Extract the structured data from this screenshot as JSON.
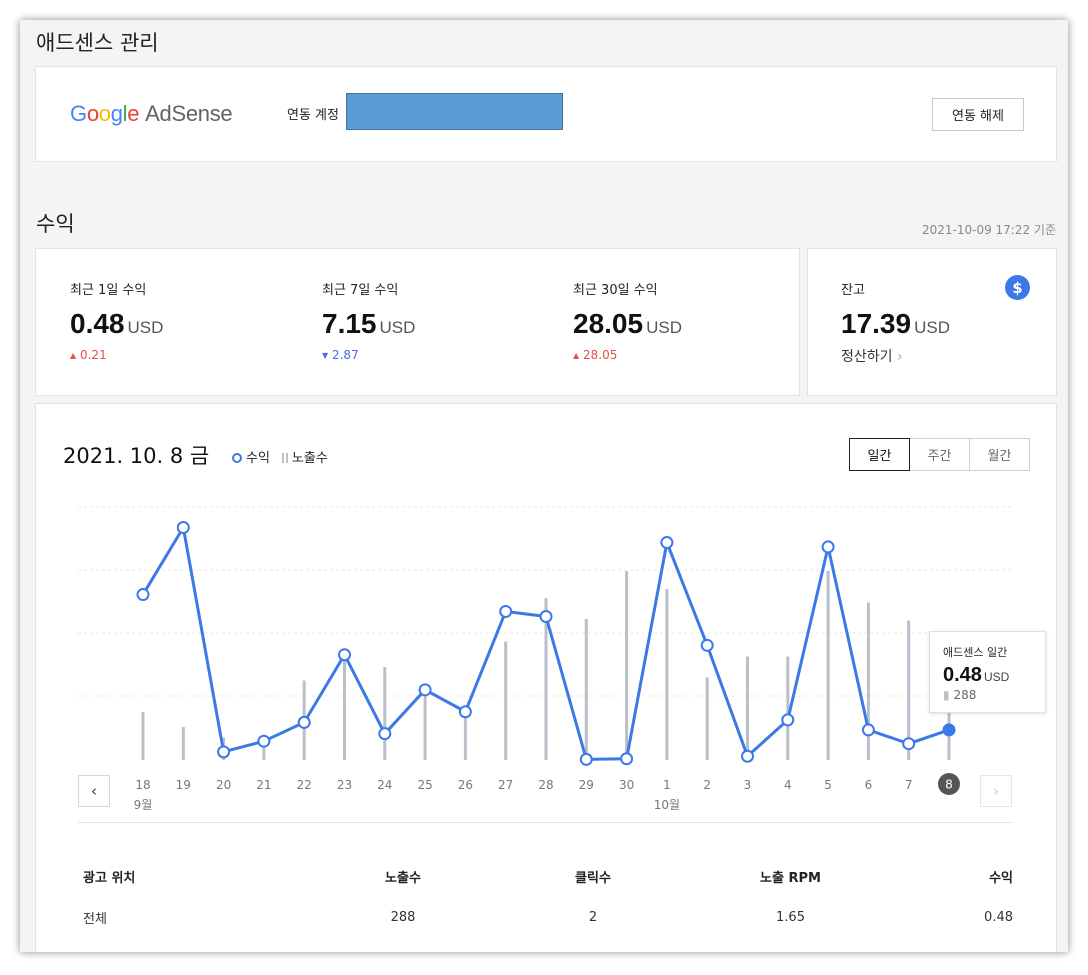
{
  "page_title": "애드센스 관리",
  "adsense": {
    "logo_google": [
      "G",
      "o",
      "o",
      "g",
      "l",
      "e"
    ],
    "logo_product": "AdSense",
    "linked_label": "연동 계정",
    "unlink_button": "연동 해제"
  },
  "revenue": {
    "title": "수익",
    "as_of": "2021-10-09 17:22 기준",
    "stats": [
      {
        "label": "최근 1일 수익",
        "value": "0.48",
        "unit": "USD",
        "change": "0.21",
        "direction": "up"
      },
      {
        "label": "최근 7일 수익",
        "value": "7.15",
        "unit": "USD",
        "change": "2.87",
        "direction": "down"
      },
      {
        "label": "최근 30일 수익",
        "value": "28.05",
        "unit": "USD",
        "change": "28.05",
        "direction": "up"
      }
    ],
    "balance": {
      "label": "잔고",
      "value": "17.39",
      "unit": "USD",
      "settle_label": "정산하기",
      "icon": "dollar-icon"
    }
  },
  "chart": {
    "date_title": "2021. 10. 8 금",
    "legend": {
      "revenue": "수익",
      "impressions": "노출수"
    },
    "tabs": [
      "일간",
      "주간",
      "월간"
    ],
    "active_tab": "일간",
    "tooltip": {
      "title": "애드센스 일간",
      "value": "0.48",
      "unit": "USD",
      "impressions": "288"
    },
    "colors": {
      "line": "#3c78e6",
      "bar": "#b9c0c9",
      "selected_day": "#555555"
    }
  },
  "chart_data": {
    "type": "line",
    "x": [
      "18",
      "19",
      "20",
      "21",
      "22",
      "23",
      "24",
      "25",
      "26",
      "27",
      "28",
      "29",
      "30",
      "1",
      "2",
      "3",
      "4",
      "5",
      "6",
      "7",
      "8"
    ],
    "month_labels": [
      {
        "index": 0,
        "label": "9월"
      },
      {
        "index": 13,
        "label": "10월"
      }
    ],
    "selected_index": 20,
    "series": [
      {
        "name": "수익",
        "type": "line",
        "values": [
          2.64,
          3.71,
          0.13,
          0.3,
          0.6,
          1.68,
          0.42,
          1.12,
          0.77,
          2.37,
          2.29,
          0.01,
          0.02,
          3.47,
          1.83,
          0.06,
          0.64,
          3.4,
          0.48,
          0.26,
          0.48
        ]
      },
      {
        "name": "노출수",
        "type": "bar",
        "values": [
          160,
          110,
          75,
          70,
          265,
          345,
          310,
          215,
          170,
          395,
          540,
          470,
          630,
          570,
          275,
          345,
          345,
          630,
          525,
          465,
          288
        ]
      }
    ]
  },
  "table": {
    "headers": [
      "광고 위치",
      "노출수",
      "클릭수",
      "노출 RPM",
      "수익"
    ],
    "rows": [
      [
        "전체",
        "288",
        "2",
        "1.65",
        "0.48"
      ]
    ]
  }
}
